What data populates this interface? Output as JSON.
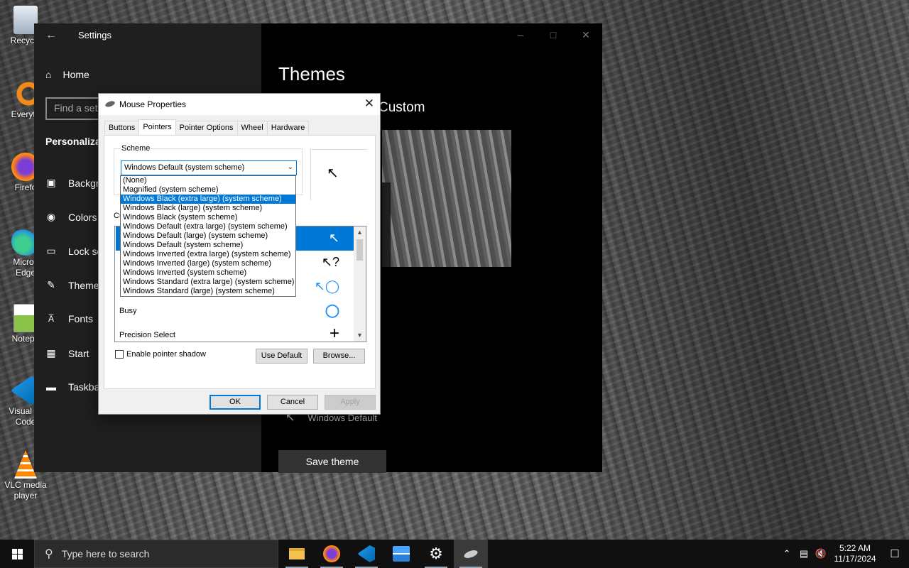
{
  "desktop": {
    "icons": [
      {
        "label": "Recycle",
        "icon": "recycle-bin-icon"
      },
      {
        "label": "Everyth",
        "icon": "everything-icon"
      },
      {
        "label": "Firefo",
        "icon": "firefox-icon"
      },
      {
        "label": "Micros Edge",
        "icon": "edge-icon"
      },
      {
        "label": "Notepa",
        "icon": "notepad-icon"
      },
      {
        "label": "Visual St Code",
        "icon": "vscode-icon"
      },
      {
        "label": "VLC media player",
        "icon": "vlc-icon"
      }
    ]
  },
  "settings": {
    "title": "Settings",
    "home": "Home",
    "search_placeholder": "Find a sett",
    "section": "Personaliza",
    "nav": [
      {
        "label": "Backgr",
        "icon": "image-icon"
      },
      {
        "label": "Colors",
        "icon": "palette-icon"
      },
      {
        "label": "Lock sc",
        "icon": "lock-screen-icon"
      },
      {
        "label": "Theme",
        "icon": "brush-icon"
      },
      {
        "label": "Fonts",
        "icon": "fonts-icon"
      },
      {
        "label": "Start",
        "icon": "start-icon"
      },
      {
        "label": "Taskba",
        "icon": "taskbar-icon"
      }
    ],
    "page_title": "Themes",
    "current_theme": "Custom",
    "cursor_label": "Windows Default",
    "save_theme": "Save theme"
  },
  "mouse_dialog": {
    "title": "Mouse Properties",
    "tabs": [
      "Buttons",
      "Pointers",
      "Pointer Options",
      "Wheel",
      "Hardware"
    ],
    "active_tab": "Pointers",
    "scheme_label": "Scheme",
    "scheme_value": "Windows Default (system scheme)",
    "customize_label": "Cu",
    "scheme_options": [
      "(None)",
      "Magnified (system scheme)",
      "Windows Black (extra large) (system scheme)",
      "Windows Black (large) (system scheme)",
      "Windows Black (system scheme)",
      "Windows Default (extra large) (system scheme)",
      "Windows Default (large) (system scheme)",
      "Windows Default (system scheme)",
      "Windows Inverted (extra large) (system scheme)",
      "Windows Inverted (large) (system scheme)",
      "Windows Inverted (system scheme)",
      "Windows Standard (extra large) (system scheme)",
      "Windows Standard (large) (system scheme)"
    ],
    "highlighted_option": "Windows Black (extra large) (system scheme)",
    "cursor_rows": [
      {
        "name": "",
        "glyph": "arrow"
      },
      {
        "name": "",
        "glyph": "help"
      },
      {
        "name": "",
        "glyph": "working"
      },
      {
        "name": "Busy",
        "glyph": "busy"
      },
      {
        "name": "Precision Select",
        "glyph": "cross"
      }
    ],
    "enable_shadow": "Enable pointer shadow",
    "shadow_checked": false,
    "use_default": "Use Default",
    "browse": "Browse...",
    "ok": "OK",
    "cancel": "Cancel",
    "apply": "Apply"
  },
  "taskbar": {
    "search_placeholder": "Type here to search",
    "apps": [
      "file-explorer-icon",
      "firefox-icon",
      "vscode-icon",
      "sandbox-icon",
      "settings-gear-icon",
      "mouse-icon"
    ],
    "time": "5:22 AM",
    "date": "11/17/2024"
  },
  "colors": {
    "accent": "#0078d7",
    "taskbar": "#101010",
    "settings_sidebar": "#1f1f1f"
  }
}
